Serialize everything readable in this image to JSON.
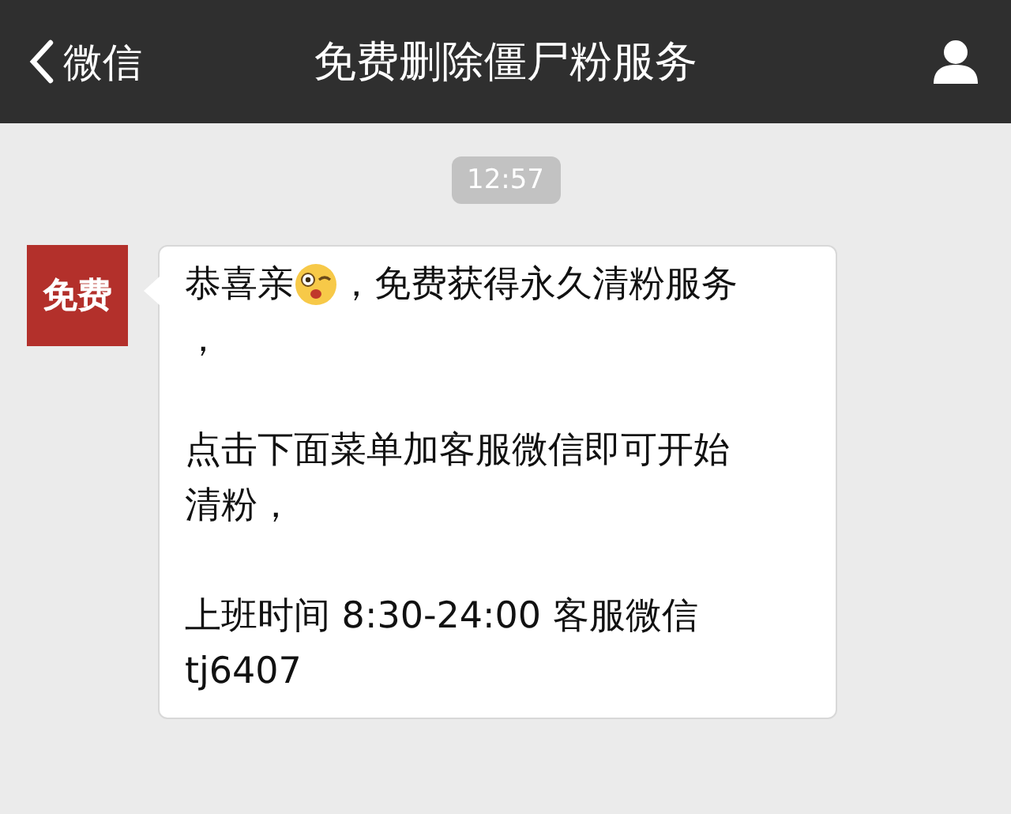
{
  "header": {
    "back_label": "微信",
    "title": "免费删除僵尸粉服务"
  },
  "timestamp": "12:57",
  "message": {
    "avatar_text": "免费",
    "paragraphs": [
      {
        "lines": [
          {
            "before": "恭喜亲",
            "emoji": true,
            "after": "，免费获得永久清粉服务"
          },
          {
            "before": "，",
            "emoji": false
          }
        ]
      },
      {
        "lines": [
          {
            "before": "点击下面菜单加客服微信即可开始",
            "emoji": false
          },
          {
            "before": "清粉，",
            "emoji": false
          }
        ]
      },
      {
        "lines": [
          {
            "before": "上班时间 8:30-24:00 客服微信",
            "emoji": false
          },
          {
            "before": "tj6407",
            "emoji": false
          }
        ]
      }
    ]
  }
}
